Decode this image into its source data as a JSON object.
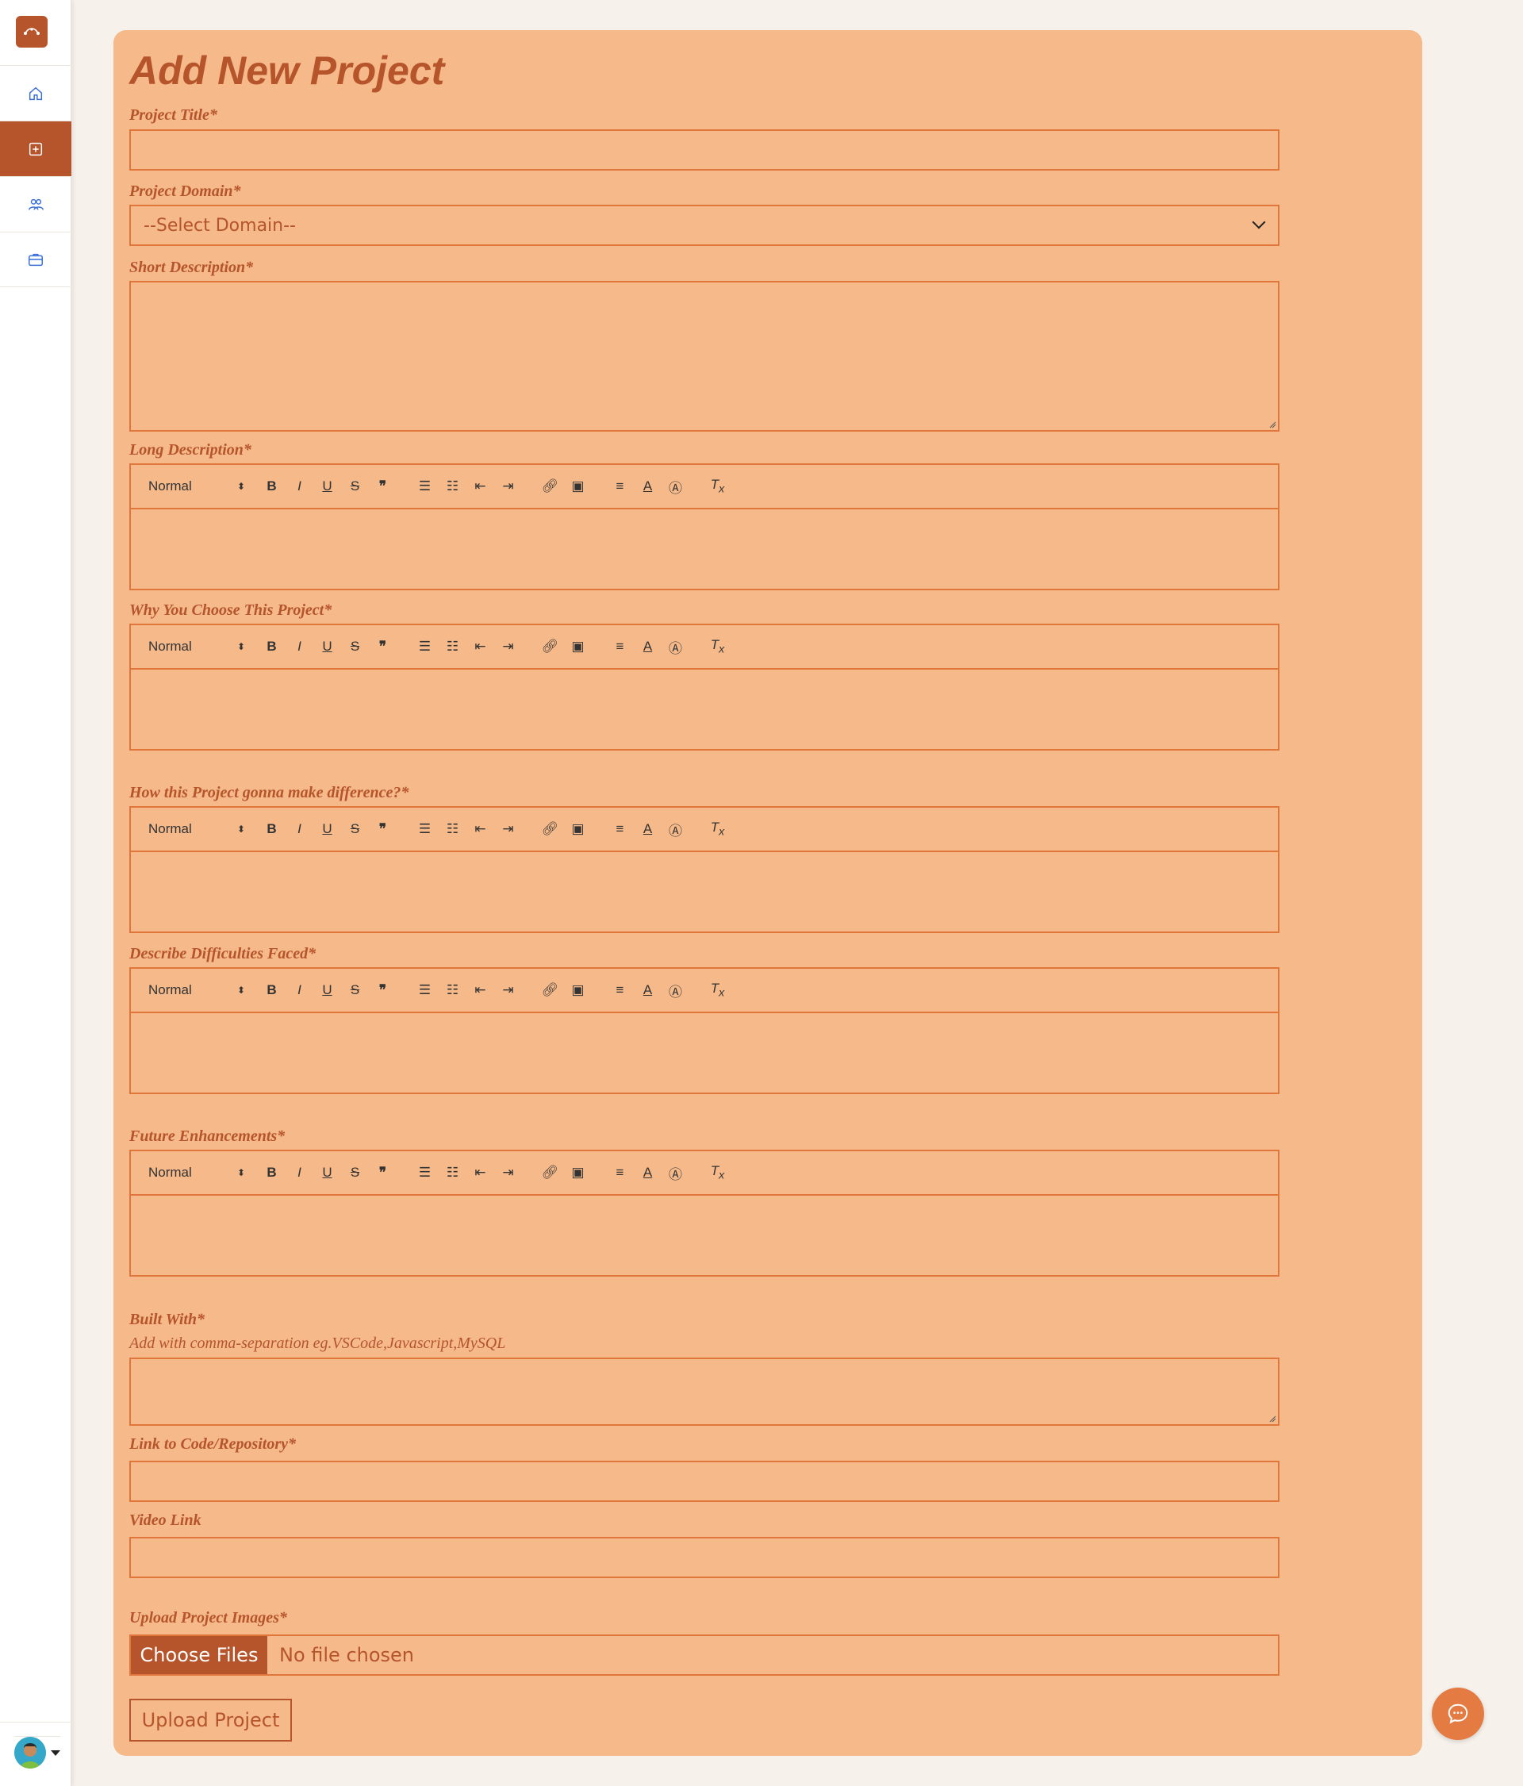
{
  "page": {
    "title": "Add New Project"
  },
  "colors": {
    "accent": "#b6542b",
    "card_bg": "#f5b98a",
    "border": "#e0763c",
    "page_bg": "#f7f1eb"
  },
  "sidebar": {
    "items": [
      {
        "icon": "home-icon",
        "active": false
      },
      {
        "icon": "add-box-icon",
        "active": true
      },
      {
        "icon": "users-icon",
        "active": false
      },
      {
        "icon": "briefcase-icon",
        "active": false
      }
    ]
  },
  "form": {
    "project_title_label": "Project Title*",
    "project_domain_label": "Project Domain*",
    "project_domain_value": "--Select Domain--",
    "short_description_label": "Short Description*",
    "long_description_label": "Long Description*",
    "why_label": "Why You Choose This Project*",
    "difference_label": "How this Project gonna make difference?*",
    "difficulties_label": "Describe Difficulties Faced*",
    "future_label": "Future Enhancements*",
    "built_with_label": "Built With*",
    "built_with_hint": "Add with comma-separation eg.VSCode,Javascript,MySQL",
    "link_label": "Link to Code/Repository*",
    "video_label": "Video Link",
    "upload_images_label": "Upload Project Images*",
    "choose_files_label": "Choose Files",
    "no_file_text": "No file chosen",
    "submit_label": "Upload Project"
  },
  "editor_toolbar": {
    "format_label": "Normal"
  }
}
